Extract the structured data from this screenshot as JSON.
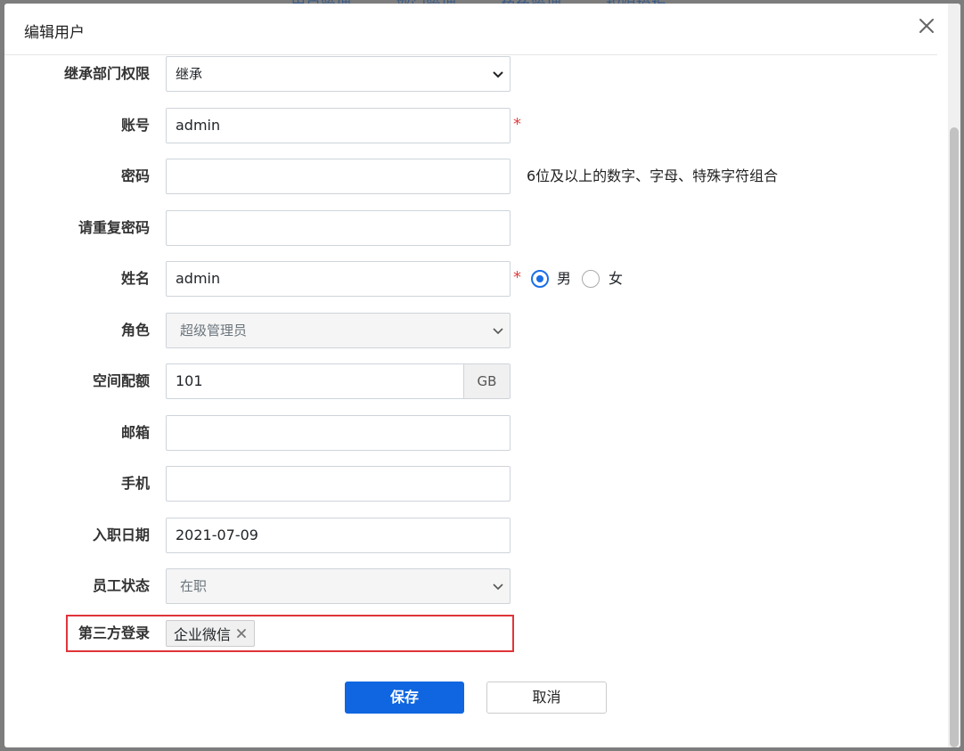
{
  "background": {
    "tabs": [
      "用户管理",
      "部门管理",
      "角色管理",
      "权限模板"
    ]
  },
  "dialog": {
    "title": "编辑用户",
    "close_label": "×"
  },
  "form": {
    "inherit": {
      "label": "继承部门权限",
      "value": "继承"
    },
    "account": {
      "label": "账号",
      "value": "admin",
      "required": "*"
    },
    "password": {
      "label": "密码",
      "value": "",
      "hint": "6位及以上的数字、字母、特殊字符组合"
    },
    "password_repeat": {
      "label": "请重复密码",
      "value": ""
    },
    "name": {
      "label": "姓名",
      "value": "admin",
      "required": "*",
      "gender_male": "男",
      "gender_female": "女",
      "gender_selected": "男"
    },
    "role": {
      "label": "角色",
      "value": "超级管理员"
    },
    "quota": {
      "label": "空间配额",
      "value": "101",
      "unit": "GB"
    },
    "email": {
      "label": "邮箱",
      "value": ""
    },
    "phone": {
      "label": "手机",
      "value": ""
    },
    "hire_date": {
      "label": "入职日期",
      "value": "2021-07-09"
    },
    "status": {
      "label": "员工状态",
      "value": "在职"
    },
    "third_party": {
      "label": "第三方登录",
      "tags": [
        "企业微信"
      ]
    }
  },
  "buttons": {
    "save": "保存",
    "cancel": "取消"
  },
  "colors": {
    "primary": "#0f66e0",
    "highlight": "#e0343a",
    "required": "#e04040"
  }
}
